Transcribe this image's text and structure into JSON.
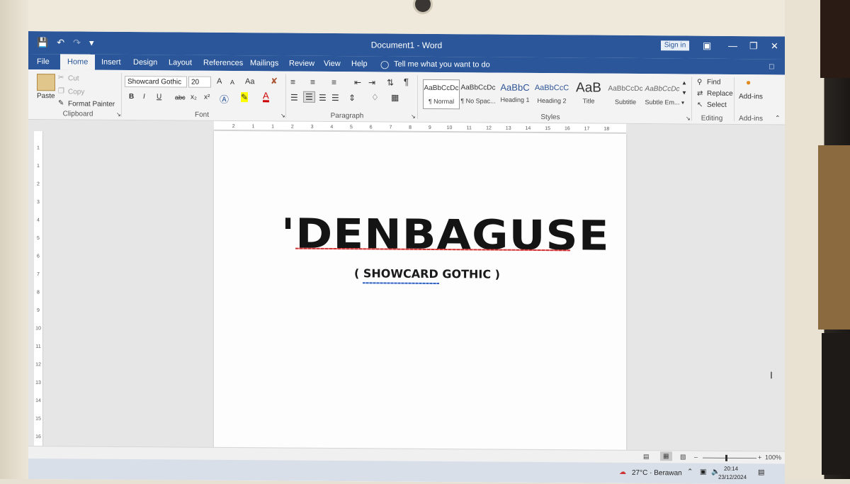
{
  "window": {
    "title": "Document1  -  Word",
    "signin": "Sign in"
  },
  "tabs": [
    "File",
    "Home",
    "Insert",
    "Design",
    "Layout",
    "References",
    "Mailings",
    "Review",
    "View",
    "Help"
  ],
  "tell_me": "Tell me what you want to do",
  "clipboard": {
    "paste": "Paste",
    "cut": "Cut",
    "copy": "Copy",
    "format_painter": "Format Painter",
    "label": "Clipboard"
  },
  "font": {
    "name": "Showcard Gothic",
    "size": "20",
    "label": "Font",
    "grow": "A",
    "shrink": "A",
    "case": "Aa",
    "bold": "B",
    "italic": "I",
    "underline": "U",
    "strike": "abc",
    "subscript": "x₂",
    "superscript": "x²"
  },
  "paragraph": {
    "label": "Paragraph"
  },
  "styles": {
    "label": "Styles",
    "items": [
      {
        "preview": "AaBbCcDc",
        "name": "¶ Normal"
      },
      {
        "preview": "AaBbCcDc",
        "name": "¶ No Spac..."
      },
      {
        "preview": "AaBbC",
        "name": "Heading 1"
      },
      {
        "preview": "AaBbCcC",
        "name": "Heading 2"
      },
      {
        "preview": "AaB",
        "name": "Title"
      },
      {
        "preview": "AaBbCcDc",
        "name": "Subtitle"
      },
      {
        "preview": "AaBbCcDc",
        "name": "Subtle Em..."
      }
    ]
  },
  "editing": {
    "find": "Find",
    "replace": "Replace",
    "select": "Select",
    "label": "Editing"
  },
  "addins": {
    "button": "Add-ins",
    "label": "Add-ins"
  },
  "ruler": {
    "h_ticks": [
      "2",
      "1",
      "1",
      "2",
      "3",
      "4",
      "5",
      "6",
      "7",
      "8",
      "9",
      "10",
      "11",
      "12",
      "13",
      "14",
      "15",
      "16",
      "17",
      "18"
    ],
    "v_ticks": [
      "1",
      "1",
      "2",
      "3",
      "4",
      "5",
      "6",
      "7",
      "8",
      "9",
      "10",
      "11",
      "12",
      "13",
      "14",
      "15",
      "16",
      "17"
    ]
  },
  "document": {
    "headline": "'DENBAGUSE",
    "subtitle": "( SHOWCARD GOTHIC )"
  },
  "statusbar": {
    "zoom": "100%"
  },
  "taskbar": {
    "weather": "27°C · Berawan",
    "time": "20:14",
    "date": "23/12/2024"
  }
}
